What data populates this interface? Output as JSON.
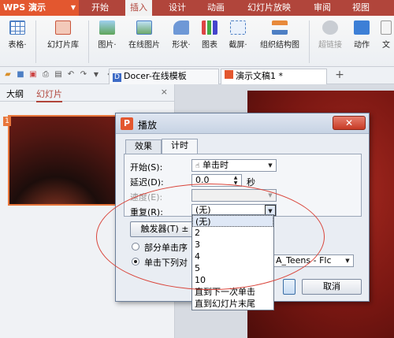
{
  "menubar": {
    "app_name": "WPS 演示",
    "items": [
      "开始",
      "插入",
      "设计",
      "动画",
      "幻灯片放映",
      "审阅",
      "视图"
    ],
    "active": "插入"
  },
  "ribbon": {
    "buttons": [
      {
        "label": "表格·",
        "icon": "table-icon"
      },
      {
        "label": "幻灯片库",
        "icon": "slide-library-icon"
      },
      {
        "label": "图片·",
        "icon": "picture-icon"
      },
      {
        "label": "在线图片",
        "icon": "online-picture-icon"
      },
      {
        "label": "形状·",
        "icon": "shape-icon"
      },
      {
        "label": "图表",
        "icon": "chart-icon"
      },
      {
        "label": "截屏·",
        "icon": "screenshot-icon"
      },
      {
        "label": "组织结构图",
        "icon": "org-chart-icon"
      },
      {
        "label": "超链接",
        "icon": "hyperlink-icon",
        "disabled": true
      },
      {
        "label": "动作",
        "icon": "action-icon"
      },
      {
        "label": "文",
        "icon": "textbox-icon"
      }
    ]
  },
  "tabs": {
    "doc1": "Docer-在线模板",
    "doc2": "演示文稿1 *",
    "add": "+"
  },
  "leftpanel": {
    "tab_outline": "大纲",
    "tab_slides": "幻灯片",
    "close": "×",
    "slide_number": "1"
  },
  "dialog": {
    "title": "播放",
    "close": "✕",
    "tab_effect": "效果",
    "tab_timing": "计时",
    "start_label": "开始(S):",
    "start_value": "单击时",
    "delay_label": "延迟(D):",
    "delay_value": "0.0",
    "delay_unit": "秒",
    "speed_label": "速度(E):",
    "repeat_label": "重复(R):",
    "repeat_value": "(无)",
    "trigger_button": "触发器(T) ±",
    "radio1": "部分单击序",
    "radio2": "单击下列对",
    "object_combo": "A_Teens - Flc",
    "cancel": "取消"
  },
  "droplist": {
    "options": [
      "(无)",
      "2",
      "3",
      "4",
      "5",
      "10",
      "直到下一次单击",
      "直到幻灯片末尾"
    ],
    "selected_index": 0
  }
}
